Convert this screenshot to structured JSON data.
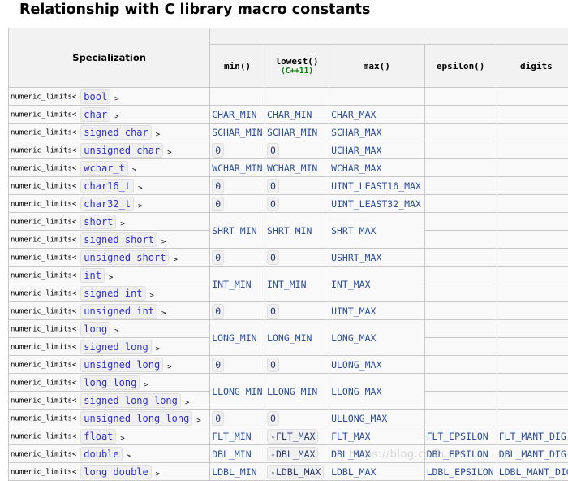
{
  "heading": "Relationship with C library macro constants",
  "table": {
    "headers": {
      "specialization": "Specialization",
      "min": "min()",
      "lowest": "lowest()",
      "lowest_note": "(C++11)",
      "max": "max()",
      "epsilon": "epsilon()",
      "digits": "digits"
    },
    "prefix": "numeric_limits<",
    "suffix": ">",
    "rows": [
      {
        "type": "bool",
        "min": "",
        "lowest": "",
        "max": "",
        "epsilon": "",
        "digits": ""
      },
      {
        "type": "char",
        "min": "CHAR_MIN",
        "lowest": "CHAR_MIN",
        "max": "CHAR_MAX",
        "epsilon": "",
        "digits": ""
      },
      {
        "type": "signed char",
        "min": "SCHAR_MIN",
        "lowest": "SCHAR_MIN",
        "max": "SCHAR_MAX",
        "epsilon": "",
        "digits": ""
      },
      {
        "type": "unsigned char",
        "min": "0",
        "lowest": "0",
        "max": "UCHAR_MAX",
        "epsilon": "",
        "digits": ""
      },
      {
        "type": "wchar_t",
        "min": "WCHAR_MIN",
        "lowest": "WCHAR_MIN",
        "max": "WCHAR_MAX",
        "epsilon": "",
        "digits": ""
      },
      {
        "type": "char16_t",
        "min": "0",
        "lowest": "0",
        "max": "UINT_LEAST16_MAX",
        "epsilon": "",
        "digits": ""
      },
      {
        "type": "char32_t",
        "min": "0",
        "lowest": "0",
        "max": "UINT_LEAST32_MAX",
        "epsilon": "",
        "digits": ""
      },
      {
        "type": "short",
        "min": "SHRT_MIN",
        "lowest": "SHRT_MIN",
        "max": "SHRT_MAX",
        "epsilon": "",
        "digits": ""
      },
      {
        "type": "signed short",
        "min": "",
        "lowest": "",
        "max": "",
        "epsilon": "",
        "digits": ""
      },
      {
        "type": "unsigned short",
        "min": "0",
        "lowest": "0",
        "max": "USHRT_MAX",
        "epsilon": "",
        "digits": ""
      },
      {
        "type": "int",
        "min": "INT_MIN",
        "lowest": "INT_MIN",
        "max": "INT_MAX",
        "epsilon": "",
        "digits": ""
      },
      {
        "type": "signed int",
        "min": "",
        "lowest": "",
        "max": "",
        "epsilon": "",
        "digits": ""
      },
      {
        "type": "unsigned int",
        "min": "0",
        "lowest": "0",
        "max": "UINT_MAX",
        "epsilon": "",
        "digits": ""
      },
      {
        "type": "long",
        "min": "LONG_MIN",
        "lowest": "LONG_MIN",
        "max": "LONG_MAX",
        "epsilon": "",
        "digits": ""
      },
      {
        "type": "signed long",
        "min": "",
        "lowest": "",
        "max": "",
        "epsilon": "",
        "digits": ""
      },
      {
        "type": "unsigned long",
        "min": "0",
        "lowest": "0",
        "max": "ULONG_MAX",
        "epsilon": "",
        "digits": ""
      },
      {
        "type": "long long",
        "min": "LLONG_MIN",
        "lowest": "LLONG_MIN",
        "max": "LLONG_MAX",
        "epsilon": "",
        "digits": ""
      },
      {
        "type": "signed long long",
        "min": "",
        "lowest": "",
        "max": "",
        "epsilon": "",
        "digits": ""
      },
      {
        "type": "unsigned long long",
        "min": "0",
        "lowest": "0",
        "max": "ULLONG_MAX",
        "epsilon": "",
        "digits": ""
      },
      {
        "type": "float",
        "min": "FLT_MIN",
        "lowest": "-FLT_MAX",
        "max": "FLT_MAX",
        "epsilon": "FLT_EPSILON",
        "digits": "FLT_MANT_DIG"
      },
      {
        "type": "double",
        "min": "DBL_MIN",
        "lowest": "-DBL_MAX",
        "max": "DBL_MAX",
        "epsilon": "DBL_EPSILON",
        "digits": "DBL_MANT_DIG"
      },
      {
        "type": "long double",
        "min": "LDBL_MIN",
        "lowest": "-LDBL_MAX",
        "max": "LDBL_MAX",
        "epsilon": "LDBL_EPSILON",
        "digits": "LDBL_MANT_DIG"
      }
    ]
  },
  "watermark": "https://blog.csdn.net/..."
}
